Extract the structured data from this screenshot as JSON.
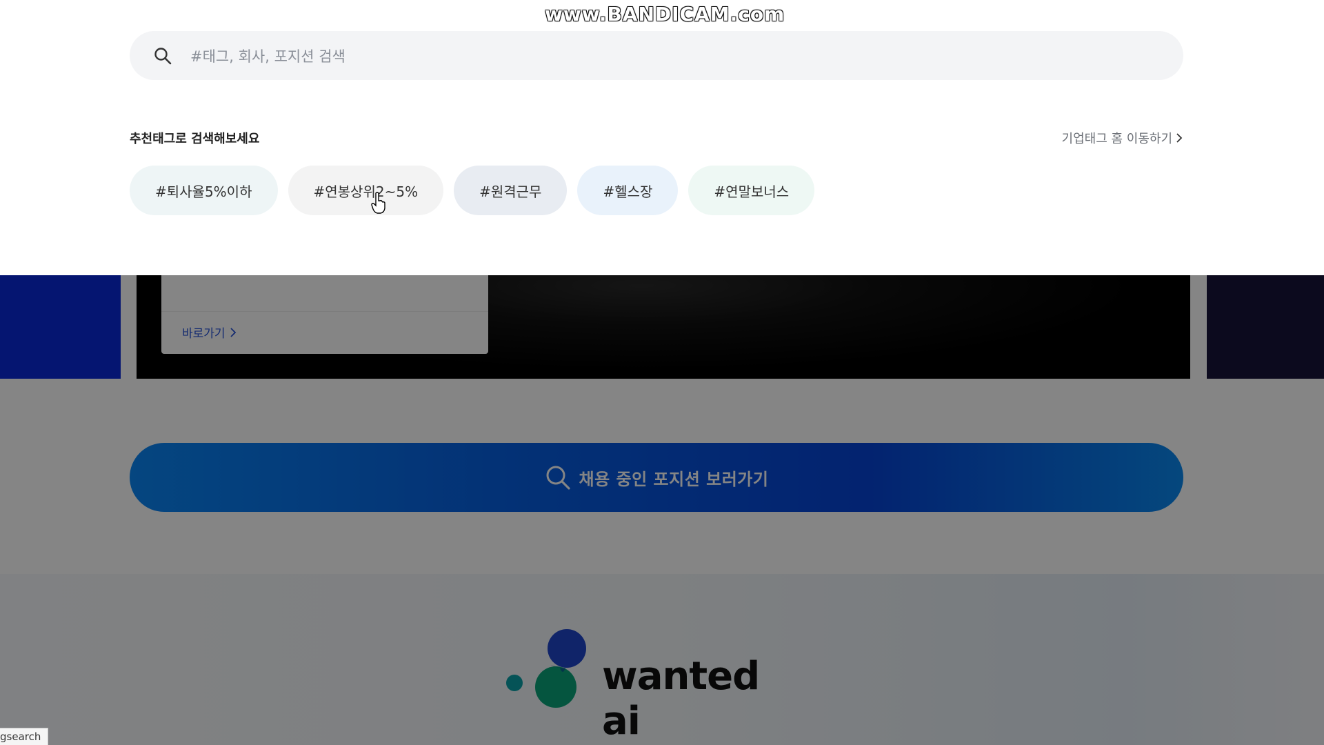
{
  "search": {
    "placeholder": "#태그, 회사, 포지션 검색"
  },
  "recommend": {
    "title": "추천태그로 검색해보세요",
    "home_link": "기업태그 홈 이동하기",
    "tags": [
      {
        "label": "#퇴사율5%이하",
        "bg": "#eef5f6"
      },
      {
        "label": "#연봉상위2~5%",
        "bg": "#f3f3f3"
      },
      {
        "label": "#원격근무",
        "bg": "#e8ecf2"
      },
      {
        "label": "#헬스장",
        "bg": "#e9f2fb"
      },
      {
        "label": "#연말보너스",
        "bg": "#eef8f4"
      }
    ]
  },
  "banner": {
    "shortcut_label": "바로가기"
  },
  "cta": {
    "label": "채용 중인 포지션 보러가기"
  },
  "ai": {
    "wordmark": "wanted ai"
  },
  "watermark": "www.BANDICAM.com",
  "status_bar": "gsearch",
  "colors": {
    "brand_blue": "#0643d6",
    "banner_blue": "#0b2ad8",
    "logo_dark_blue": "#1f46c9",
    "logo_green": "#0aa37a",
    "logo_teal": "#0aa0a8"
  }
}
